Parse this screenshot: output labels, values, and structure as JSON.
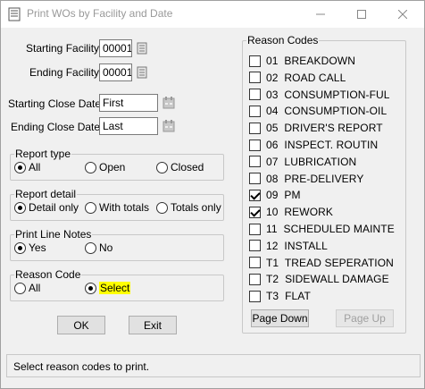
{
  "window": {
    "title": "Print WOs by Facility and Date",
    "app_icon": "document-icon",
    "min_icon": "minimize-icon",
    "max_icon": "maximize-icon",
    "close_icon": "close-icon"
  },
  "form": {
    "starting_facility_label": "Starting Facility:",
    "starting_facility_value": "00001",
    "ending_facility_label": "Ending Facility:",
    "ending_facility_value": "00001",
    "starting_close_date_label": "Starting Close Date:",
    "starting_close_date_value": "First",
    "ending_close_date_label": "Ending Close Date:",
    "ending_close_date_value": "Last"
  },
  "report_type": {
    "title": "Report type",
    "options": [
      "All",
      "Open",
      "Closed"
    ],
    "selected": "All"
  },
  "report_detail": {
    "title": "Report detail",
    "options": [
      "Detail only",
      "With totals",
      "Totals only"
    ],
    "selected": "Detail only"
  },
  "print_line_notes": {
    "title": "Print Line Notes",
    "options": [
      "Yes",
      "No"
    ],
    "selected": "Yes"
  },
  "reason_code": {
    "title": "Reason Code",
    "options": [
      "All",
      "Select"
    ],
    "selected": "Select",
    "highlight_color": "#ffff00"
  },
  "buttons": {
    "ok": "OK",
    "exit": "Exit",
    "page_down": "Page Down",
    "page_up": "Page Up"
  },
  "reason_codes": {
    "title": "Reason Codes",
    "items": [
      {
        "label": "01  BREAKDOWN",
        "checked": false
      },
      {
        "label": "02  ROAD CALL",
        "checked": false
      },
      {
        "label": "03  CONSUMPTION-FUL",
        "checked": false
      },
      {
        "label": "04  CONSUMPTION-OIL",
        "checked": false
      },
      {
        "label": "05  DRIVER'S REPORT",
        "checked": false
      },
      {
        "label": "06  INSPECT. ROUTIN",
        "checked": false
      },
      {
        "label": "07  LUBRICATION",
        "checked": false
      },
      {
        "label": "08  PRE-DELIVERY",
        "checked": false
      },
      {
        "label": "09  PM",
        "checked": true
      },
      {
        "label": "10  REWORK",
        "checked": true
      },
      {
        "label": "11  SCHEDULED MAINTE",
        "checked": false
      },
      {
        "label": "12  INSTALL",
        "checked": false
      },
      {
        "label": "T1  TREAD SEPERATION",
        "checked": false
      },
      {
        "label": "T2  SIDEWALL DAMAGE",
        "checked": false
      },
      {
        "label": "T3  FLAT",
        "checked": false
      }
    ]
  },
  "status": {
    "text": "Select reason codes to print."
  }
}
